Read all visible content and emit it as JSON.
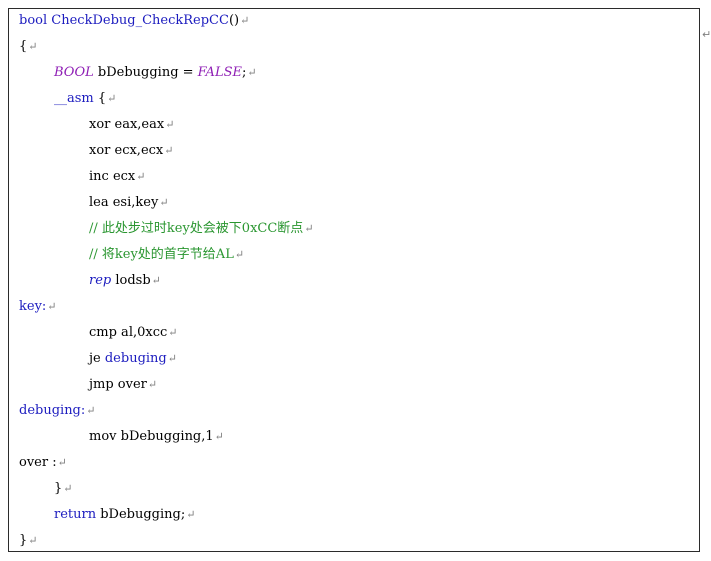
{
  "paragraph_mark": "↵",
  "outside_mark": "↵",
  "colors": {
    "keyword": "#1c1cbf",
    "type": "#8f1fb5",
    "comment": "#2a9630",
    "plain": "#000000",
    "mark": "#7f7f7f"
  },
  "lines": [
    {
      "indent": 0,
      "tokens": [
        {
          "t": "bool",
          "c": "keyword"
        },
        {
          "t": " ",
          "c": "plain"
        },
        {
          "t": "CheckDebug_CheckRepCC",
          "c": "func"
        },
        {
          "t": "()",
          "c": "plain"
        }
      ]
    },
    {
      "indent": 0,
      "tokens": [
        {
          "t": "{",
          "c": "plain"
        }
      ]
    },
    {
      "indent": 1,
      "tokens": [
        {
          "t": "BOOL",
          "c": "type-italic"
        },
        {
          "t": " bDebugging = ",
          "c": "plain"
        },
        {
          "t": "FALSE",
          "c": "type-italic"
        },
        {
          "t": ";",
          "c": "plain"
        }
      ]
    },
    {
      "indent": 1,
      "tokens": [
        {
          "t": "__asm",
          "c": "keyword"
        },
        {
          "t": " {",
          "c": "plain"
        }
      ]
    },
    {
      "indent": 2,
      "tokens": [
        {
          "t": "xor eax,eax",
          "c": "plain"
        }
      ]
    },
    {
      "indent": 2,
      "tokens": [
        {
          "t": "xor ecx,ecx",
          "c": "plain"
        }
      ]
    },
    {
      "indent": 2,
      "tokens": [
        {
          "t": "inc ecx",
          "c": "plain"
        }
      ]
    },
    {
      "indent": 2,
      "tokens": [
        {
          "t": "lea esi,key",
          "c": "plain"
        }
      ]
    },
    {
      "indent": 2,
      "tokens": [
        {
          "t": "// 此处步过时key处会被下0xCC断点",
          "c": "comment"
        }
      ]
    },
    {
      "indent": 2,
      "tokens": [
        {
          "t": "// 将key处的首字节给AL",
          "c": "comment"
        }
      ]
    },
    {
      "indent": 2,
      "tokens": [
        {
          "t": "rep",
          "c": "keyword-italic"
        },
        {
          "t": " lodsb",
          "c": "plain"
        }
      ]
    },
    {
      "indent": 0,
      "tokens": [
        {
          "t": "key:",
          "c": "label"
        }
      ]
    },
    {
      "indent": 2,
      "tokens": [
        {
          "t": "cmp al,0xcc",
          "c": "plain"
        }
      ]
    },
    {
      "indent": 2,
      "tokens": [
        {
          "t": "je ",
          "c": "plain"
        },
        {
          "t": "debuging",
          "c": "label"
        }
      ]
    },
    {
      "indent": 2,
      "tokens": [
        {
          "t": "jmp over",
          "c": "plain"
        }
      ]
    },
    {
      "indent": 0,
      "tokens": [
        {
          "t": "debuging:",
          "c": "label"
        }
      ]
    },
    {
      "indent": 2,
      "tokens": [
        {
          "t": "mov bDebugging,1",
          "c": "plain"
        }
      ]
    },
    {
      "indent": 0,
      "tokens": [
        {
          "t": "over :",
          "c": "plain"
        }
      ]
    },
    {
      "indent": 1,
      "tokens": [
        {
          "t": "}",
          "c": "plain"
        }
      ]
    },
    {
      "indent": 1,
      "tokens": [
        {
          "t": "return",
          "c": "keyword"
        },
        {
          "t": " bDebugging;",
          "c": "plain"
        }
      ]
    },
    {
      "indent": 0,
      "tokens": [
        {
          "t": "}",
          "c": "plain"
        }
      ]
    }
  ]
}
